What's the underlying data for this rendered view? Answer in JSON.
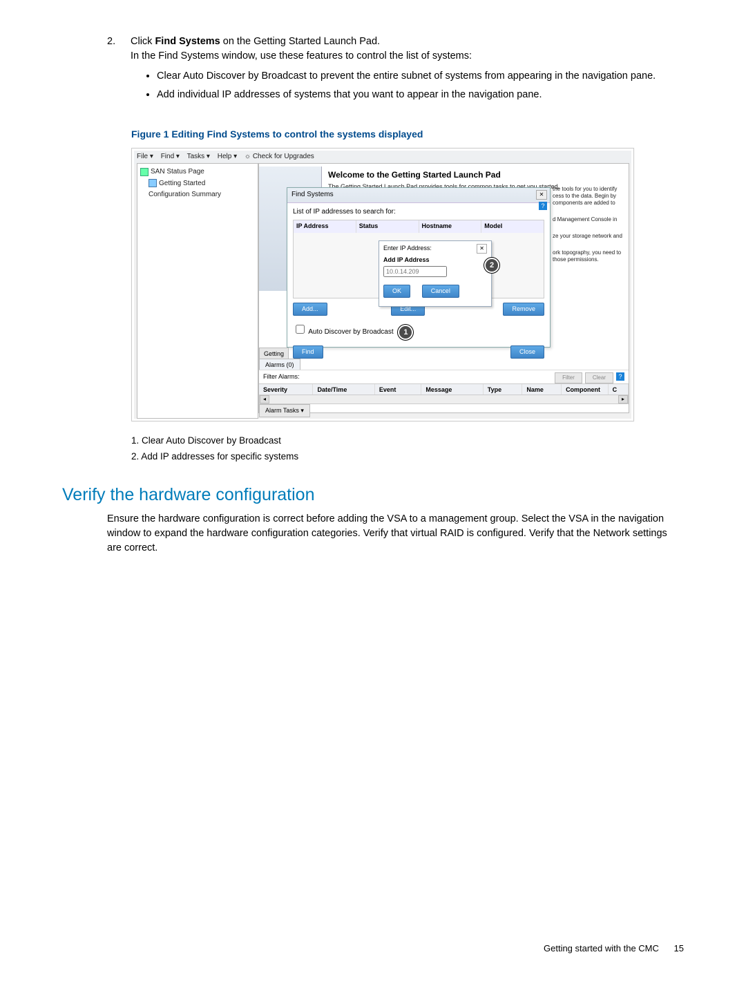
{
  "step": {
    "number": "2.",
    "line1_a": "Click ",
    "line1_b": "Find Systems",
    "line1_c": " on the Getting Started Launch Pad.",
    "line2": "In the Find Systems window, use these features to control the list of systems:",
    "bullets": [
      "Clear Auto Discover by Broadcast to prevent the entire subnet of systems from appearing in the navigation pane.",
      "Add individual IP addresses of systems that you want to appear in the navigation pane."
    ]
  },
  "figure_caption": "Figure 1 Editing Find Systems to control the systems displayed",
  "screenshot": {
    "menubar": {
      "file": "File ▾",
      "find": "Find ▾",
      "tasks": "Tasks ▾",
      "help": "Help ▾",
      "check": "☼ Check for Upgrades"
    },
    "nav": {
      "item1": "SAN Status Page",
      "item2": "Getting Started",
      "item3": "Configuration Summary"
    },
    "welcome": {
      "title": "Welcome to the Getting Started Launch Pad",
      "sub": "The Getting Started Launch Pad provides tools for common tasks to get you started."
    },
    "find_dialog": {
      "title": "Find Systems",
      "close": "✕",
      "list_label": "List of IP addresses to search for:",
      "cols": {
        "ip": "IP Address",
        "status": "Status",
        "host": "Hostname",
        "model": "Model"
      },
      "btn_add": "Add...",
      "btn_edit": "Edit...",
      "btn_remove": "Remove",
      "checkbox": "Auto Discover by Broadcast",
      "btn_find": "Find",
      "btn_close": "Close"
    },
    "enter_ip": {
      "title": "Enter IP Address:",
      "bold": "Add IP Address",
      "placeholder": "10.0.14.209",
      "btn_ok": "OK",
      "btn_cancel": "Cancel",
      "close": "✕"
    },
    "tips": {
      "t1": "the tools for you to identify cess to the data. Begin by components are added to",
      "t2": "d Management Console in",
      "t3": "ze your storage network and",
      "t4": "ork topography, you need to those permissions."
    },
    "bottom": {
      "getting": "Getting",
      "alarms_tab": "Alarms (0)",
      "filter_label": "Filter Alarms:",
      "btn_filter": "Filter",
      "btn_clear": "Clear",
      "help": "?",
      "cols": {
        "sev": "Severity",
        "dt": "Date/Time",
        "evt": "Event",
        "msg": "Message",
        "type": "Type",
        "name": "Name",
        "comp": "Component",
        "c": "C"
      },
      "alarm_tasks": "Alarm Tasks ▾"
    },
    "callouts": {
      "c1": "1",
      "c2": "2"
    }
  },
  "legend": {
    "l1": "1. Clear Auto Discover by Broadcast",
    "l2": "2. Add IP addresses for specific systems"
  },
  "section": {
    "heading": "Verify the hardware configuration",
    "body": "Ensure the hardware configuration is correct before adding the VSA to a management group. Select the VSA in the navigation window to expand the hardware configuration categories. Verify that virtual RAID is configured. Verify that the Network settings are correct."
  },
  "footer": {
    "text": "Getting started with the CMC",
    "page": "15"
  }
}
